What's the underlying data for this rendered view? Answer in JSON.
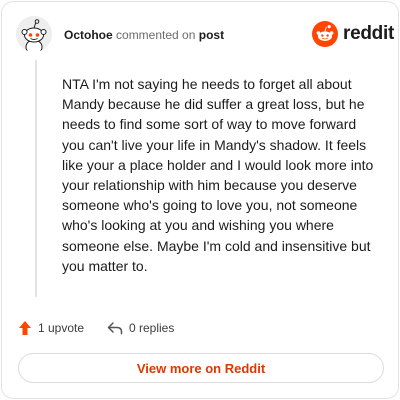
{
  "header": {
    "author": "Octohoe",
    "action": "commented on",
    "post_link": "post",
    "brand_name": "reddit"
  },
  "comment": {
    "text": "NTA I'm not saying he needs to forget all about Mandy because he did suffer a great loss, but he needs to find some sort of way to move forward you can't live your life in Mandy's shadow. It feels like your a place holder and I would look more into your relationship with him because you deserve someone who's going to love you, not someone who's looking at you and wishing you where someone else. Maybe I'm cold and insensitive but you matter to."
  },
  "footer": {
    "upvotes": "1 upvote",
    "replies": "0 replies",
    "view_button": "View more on Reddit"
  },
  "icons": {
    "avatar": "snoo-avatar-icon",
    "brand": "reddit-logo-icon",
    "upvote": "upvote-arrow-icon",
    "reply": "reply-arrow-icon"
  },
  "colors": {
    "brand_orange": "#ff4500",
    "upvote_orange": "#ff4500",
    "button_text": "#d93a00"
  }
}
